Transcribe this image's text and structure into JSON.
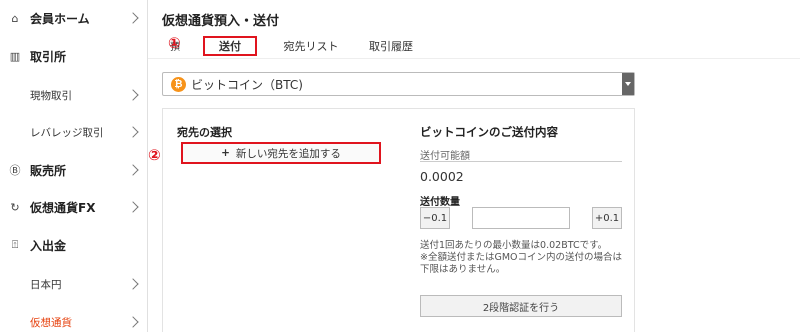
{
  "sidebar": {
    "items": [
      {
        "label": "会員ホーム",
        "icon": "home-icon",
        "glyph": "⌂"
      },
      {
        "label": "取引所",
        "icon": "exchange-icon",
        "glyph": "▥"
      },
      {
        "label": "現物取引"
      },
      {
        "label": "レバレッジ取引"
      },
      {
        "label": "販売所",
        "icon": "coin-icon",
        "glyph": "Ⓑ"
      },
      {
        "label": "仮想通貨FX",
        "icon": "fx-icon",
        "glyph": "↻"
      },
      {
        "label": "入出金",
        "icon": "deposit-icon",
        "glyph": "⍐"
      },
      {
        "label": "日本円"
      },
      {
        "label": "仮想通貨"
      }
    ]
  },
  "main": {
    "title": "仮想通貨預入・送付",
    "tabs": [
      {
        "label": "送付"
      },
      {
        "label": "宛先リスト"
      },
      {
        "label": "取引履歴"
      }
    ],
    "tab_cut": "預",
    "badge1": "①",
    "badge2": "②",
    "select": {
      "value": "ビットコイン（BTC)",
      "icon_glyph": "₿"
    },
    "destination": {
      "title": "宛先の選択",
      "add_button": "新しい宛先を追加する",
      "plus": "+"
    },
    "send": {
      "title": "ビットコインのご送付内容",
      "available_label": "送付可能額",
      "available_value": "0.0002",
      "quantity_label": "送付数量",
      "minus_label": "−0.1",
      "plus_label": "+0.1",
      "note1": "送付1回あたりの最小数量は0.02BTCです。",
      "note2": "※全額送付またはGMOコイン内の送付の場合は",
      "note3": "下限はありません。",
      "twofa_button": "2段階認証を行う"
    }
  },
  "colors": {
    "accent": "#e0141e",
    "active_nav": "#e6420f",
    "btc": "#f7931a"
  }
}
